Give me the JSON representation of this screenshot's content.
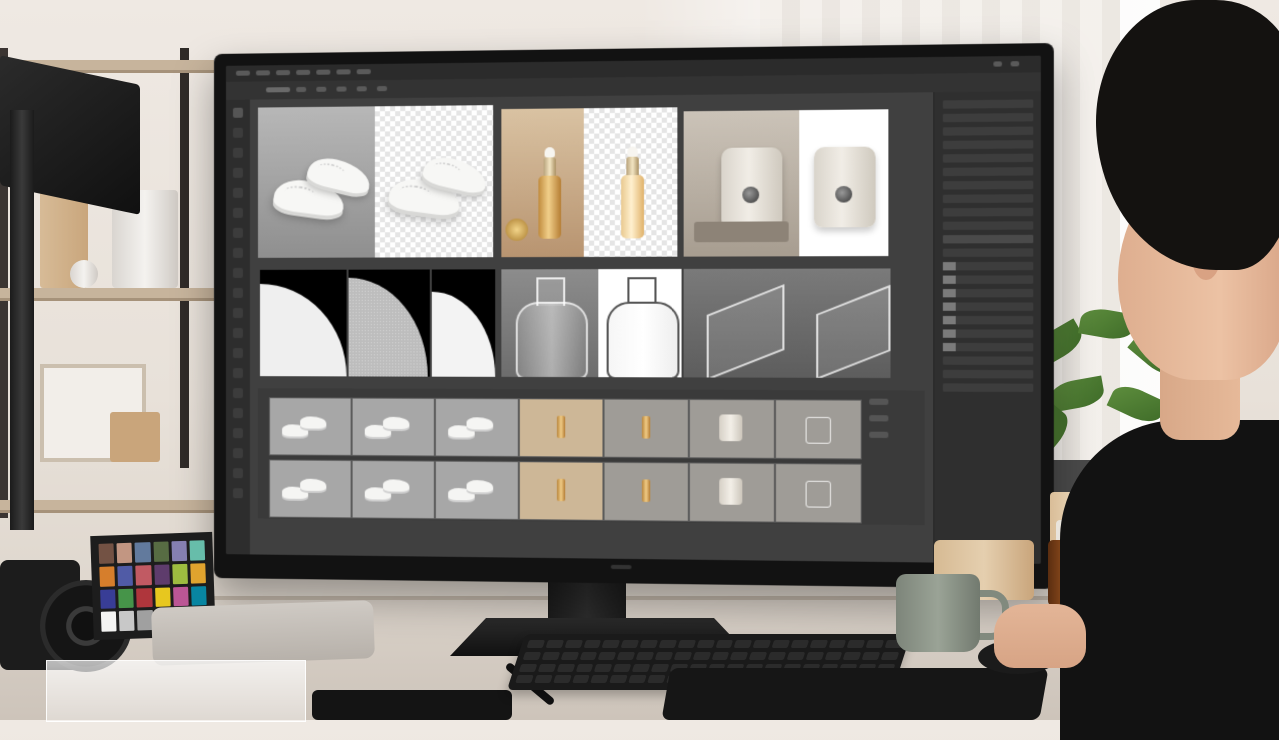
{
  "scene": {
    "description_tag": "photo-editing-workstation",
    "accent_colors": {
      "ui_dark": "#2b2b2b",
      "canvas": "#404040",
      "plant_green": "#4f7f34",
      "wood": "#d4b48c"
    }
  },
  "editor": {
    "toolbar_icons": [
      "move-icon",
      "marquee-icon",
      "lasso-icon",
      "magic-wand-icon",
      "crop-icon",
      "eyedropper-icon",
      "healing-icon",
      "brush-icon",
      "stamp-icon",
      "history-brush-icon",
      "eraser-icon",
      "gradient-icon",
      "blur-icon",
      "dodge-icon",
      "pen-icon",
      "type-icon",
      "path-select-icon",
      "shape-icon",
      "hand-icon",
      "zoom-icon"
    ],
    "grid_tiles": [
      {
        "name": "sneakers-before-after"
      },
      {
        "name": "serum-bottle-before-after"
      },
      {
        "name": "diffuser-before-after"
      },
      {
        "name": "texture-mask-strip"
      },
      {
        "name": "glass-bottle-before-after"
      },
      {
        "name": "acrylic-display-before-after"
      }
    ],
    "filmstrip": {
      "rows": 2,
      "items": [
        "sneakers",
        "sneakers",
        "sneakers",
        "serum",
        "serum",
        "diffuser",
        "glass-cup"
      ]
    }
  },
  "color_checker": {
    "swatches": [
      "#735244",
      "#c29682",
      "#627a9d",
      "#576c43",
      "#8580b1",
      "#67bdaa",
      "#d67e2c",
      "#505ba6",
      "#c15a63",
      "#5e3c6c",
      "#9dbc40",
      "#e0a32e",
      "#383d96",
      "#469449",
      "#af363c",
      "#e7c71f",
      "#bb5695",
      "#0885a1",
      "#f3f3f2",
      "#c8c8c8",
      "#a0a0a0",
      "#7a7a79",
      "#555555",
      "#343434"
    ]
  }
}
